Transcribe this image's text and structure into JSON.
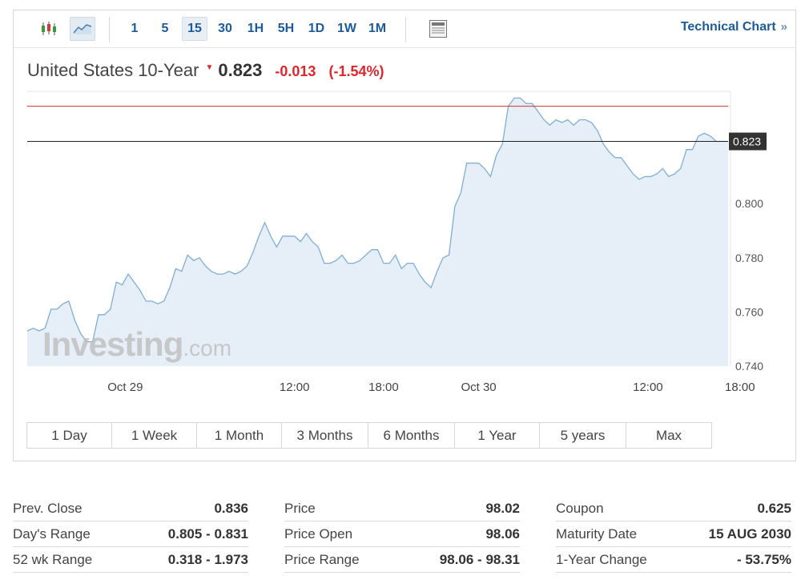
{
  "toolbar": {
    "chart_type_icons": [
      "candlestick-icon",
      "area-chart-icon"
    ],
    "intervals": [
      "1",
      "5",
      "15",
      "30",
      "1H",
      "5H",
      "1D",
      "1W",
      "1M"
    ],
    "active_interval": "15",
    "extra_icon": "calendar-panel-icon",
    "technical_chart_label": "Technical Chart",
    "technical_chart_chevron": "»"
  },
  "instrument": {
    "name": "United States 10-Year",
    "price": "0.823",
    "change": "-0.013",
    "change_pct": "(-1.54%)",
    "direction": "down"
  },
  "colors": {
    "accent": "#1c5a9c",
    "negative": "#e0252b",
    "line": "#7eaed6",
    "fill": "#e6eef7",
    "prev_close_line": "#d03030"
  },
  "watermark": {
    "brand": "Investing",
    "suffix": ".com"
  },
  "chart_data": {
    "type": "area",
    "title": "",
    "xlabel": "",
    "ylabel": "",
    "ylim": [
      0.74,
      0.8415
    ],
    "y_ticks": [
      "0.800",
      "0.780",
      "0.760",
      "0.740"
    ],
    "x_tick_labels": [
      {
        "label": "Oct 29",
        "t": 16.5
      },
      {
        "label": "12:00",
        "t": 45
      },
      {
        "label": "18:00",
        "t": 60
      },
      {
        "label": "Oct 30",
        "t": 76
      },
      {
        "label": "12:00",
        "t": 104.5
      },
      {
        "label": "18:00",
        "t": 120
      }
    ],
    "last_price_label": "0.823",
    "reference_lines": [
      {
        "name": "Prev. Close",
        "value": 0.836
      },
      {
        "name": "Last",
        "value": 0.823
      }
    ],
    "series": [
      {
        "values": [
          0.753,
          0.754,
          0.753,
          0.754,
          0.761,
          0.761,
          0.763,
          0.764,
          0.757,
          0.752,
          0.749,
          0.749,
          0.759,
          0.759,
          0.761,
          0.771,
          0.77,
          0.774,
          0.771,
          0.768,
          0.764,
          0.764,
          0.763,
          0.764,
          0.769,
          0.776,
          0.775,
          0.781,
          0.779,
          0.78,
          0.777,
          0.775,
          0.774,
          0.774,
          0.775,
          0.774,
          0.775,
          0.777,
          0.782,
          0.788,
          0.793,
          0.788,
          0.784,
          0.788,
          0.788,
          0.788,
          0.786,
          0.789,
          0.786,
          0.784,
          0.778,
          0.778,
          0.779,
          0.781,
          0.778,
          0.778,
          0.779,
          0.781,
          0.783,
          0.783,
          0.778,
          0.778,
          0.781,
          0.776,
          0.778,
          0.778,
          0.774,
          0.771,
          0.769,
          0.775,
          0.78,
          0.781,
          0.799,
          0.804,
          0.815,
          0.815,
          0.815,
          0.813,
          0.81,
          0.818,
          0.822,
          0.836,
          0.839,
          0.839,
          0.837,
          0.837,
          0.834,
          0.831,
          0.829,
          0.831,
          0.83,
          0.831,
          0.829,
          0.831,
          0.831,
          0.83,
          0.827,
          0.822,
          0.819,
          0.817,
          0.817,
          0.814,
          0.811,
          0.809,
          0.81,
          0.81,
          0.811,
          0.813,
          0.81,
          0.811,
          0.813,
          0.82,
          0.82,
          0.825,
          0.826,
          0.825,
          0.823,
          0.823,
          0.823
        ]
      }
    ]
  },
  "ranges": [
    "1 Day",
    "1 Week",
    "1 Month",
    "3 Months",
    "6 Months",
    "1 Year",
    "5 years",
    "Max"
  ],
  "stats": [
    [
      {
        "label": "Prev. Close",
        "value": "0.836"
      },
      {
        "label": "Day's Range",
        "value": "0.805 - 0.831"
      },
      {
        "label": "52 wk Range",
        "value": "0.318 - 1.973"
      }
    ],
    [
      {
        "label": "Price",
        "value": "98.02"
      },
      {
        "label": "Price Open",
        "value": "98.06"
      },
      {
        "label": "Price Range",
        "value": "98.06 - 98.31"
      }
    ],
    [
      {
        "label": "Coupon",
        "value": "0.625"
      },
      {
        "label": "Maturity Date",
        "value": "15 AUG 2030"
      },
      {
        "label": "1-Year Change",
        "value": "- 53.75%"
      }
    ]
  ]
}
